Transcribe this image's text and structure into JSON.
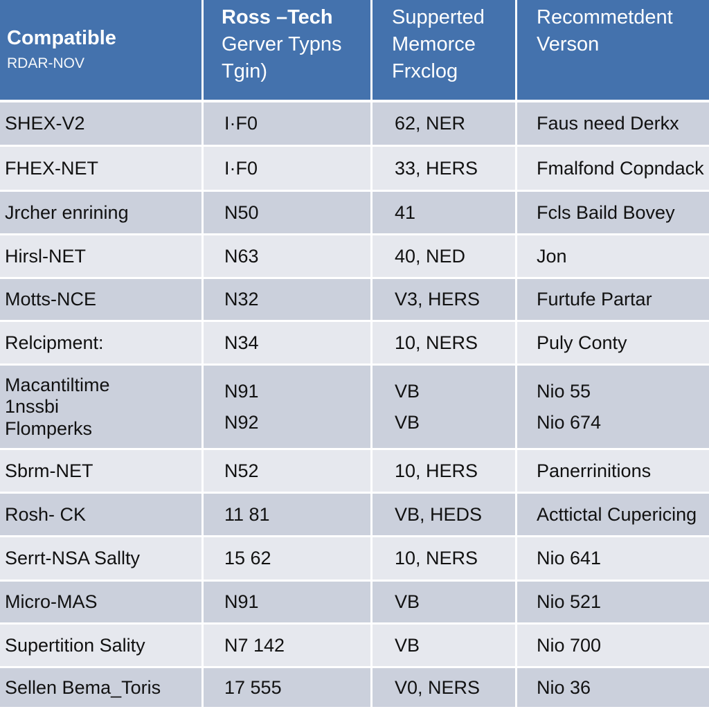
{
  "colors": {
    "header_bg": "#4472ad",
    "header_text": "#ffffff",
    "row_dark": "#cbd0dc",
    "row_light": "#e6e8ee",
    "grid_line": "#ffffff"
  },
  "header": {
    "col0": {
      "title": "Compatible",
      "subtitle": "RDAR-NOV"
    },
    "col1": {
      "lines": [
        "Ross –Tech",
        "Gerver Typns",
        "Tgin)"
      ]
    },
    "col2": {
      "lines": [
        "Supperted",
        "Memorce",
        "Frxclog"
      ]
    },
    "col3": {
      "lines": [
        "Recommetdent",
        "Verson"
      ]
    }
  },
  "rows": [
    {
      "c0": "SHEX-V2",
      "c1": "I·F0",
      "c2": "62, NER",
      "c3": "Faus need Derkx"
    },
    {
      "c0": "FHEX-NET",
      "c1": "I·F0",
      "c2": "33, HERS",
      "c3": "Fmalfond Copndack"
    },
    {
      "c0": "Jrcher enrining",
      "c1": "N50",
      "c2": "41",
      "c3": "Fcls Baild Bovey"
    },
    {
      "c0": "Hirsl-NET",
      "c1": "N63",
      "c2": "40, NED",
      "c3": "Jon"
    },
    {
      "c0": "Motts-NCE",
      "c1": "N32",
      "c2": "V3, HERS",
      "c3": "Furtufe Partar"
    },
    {
      "c0": "Relcipment:",
      "c1": "N34",
      "c2": "10, NERS",
      "c3": "Puly Conty"
    },
    {
      "c0": [
        "Macantiltime",
        "1nssbi",
        "Flomperks"
      ],
      "c1": [
        "N91",
        "N92"
      ],
      "c2": [
        "VB",
        "VB"
      ],
      "c3": [
        "Nio 55",
        "Nio 674"
      ]
    },
    {
      "c0": "Sbrm-NET",
      "c1": "N52",
      "c2": "10, HERS",
      "c3": "Panerrinitions"
    },
    {
      "c0": "Rosh- CK",
      "c1": "11 81",
      "c2": "VB, HEDS",
      "c3": "Acttictal Cupericing"
    },
    {
      "c0": "Serrt-NSA Sallty",
      "c1": "15 62",
      "c2": "10, NERS",
      "c3": "Nio 641"
    },
    {
      "c0": "Micro-MAS",
      "c1": "N91",
      "c2": "VB",
      "c3": "Nio 521"
    },
    {
      "c0": "Supertition Sality",
      "c1": "N7 142",
      "c2": "VB",
      "c3": "Nio 700"
    },
    {
      "c0": "Sellen Bema_Toris",
      "c1": "17 555",
      "c2": "V0, NERS",
      "c3": "Nio 36"
    }
  ]
}
